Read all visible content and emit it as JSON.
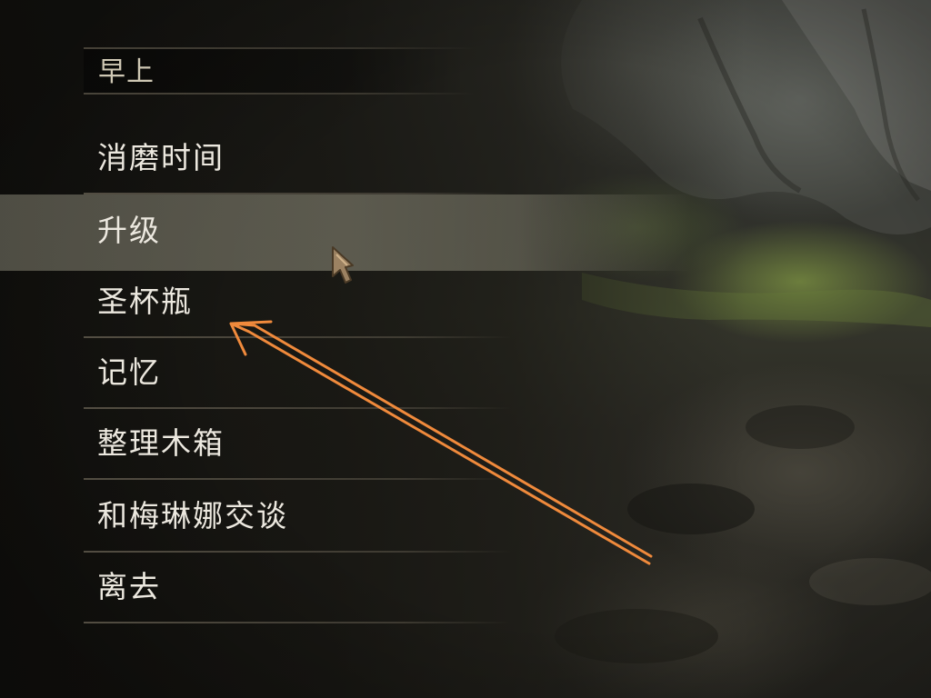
{
  "menu": {
    "header": "早上",
    "items": [
      {
        "label": "消磨时间"
      },
      {
        "label": "升级",
        "highlighted": true
      },
      {
        "label": "圣杯瓶"
      },
      {
        "label": "记忆"
      },
      {
        "label": "整理木箱"
      },
      {
        "label": "和梅琳娜交谈"
      },
      {
        "label": "离去"
      }
    ]
  },
  "colors": {
    "menu_text": "#ece8df",
    "header_text": "#cfc8b4",
    "annotation_arrow": "#f08a3c"
  },
  "icons": {
    "cursor": "gauntlet-cursor-icon",
    "annotation": "arrow-annotation"
  }
}
